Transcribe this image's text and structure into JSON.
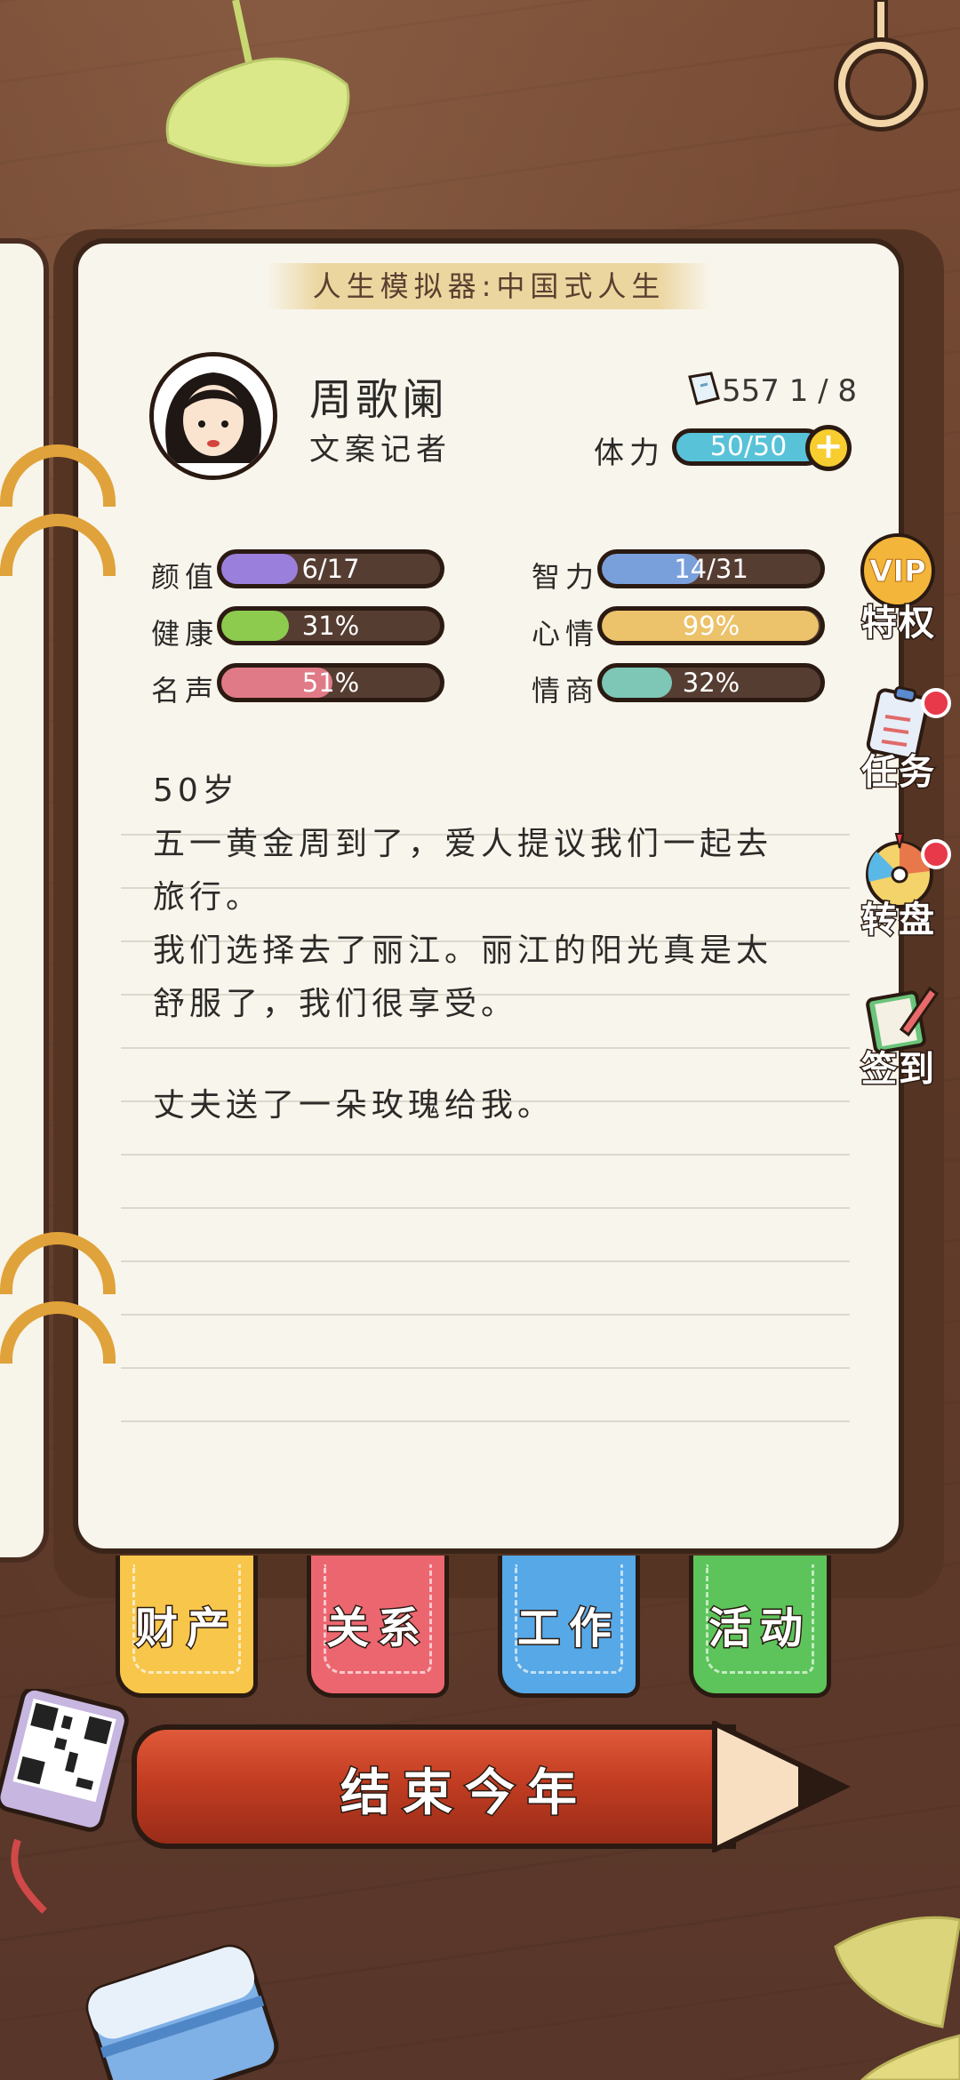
{
  "header": {
    "title": "人生模拟器:中国式人生"
  },
  "profile": {
    "name": "周歌阑",
    "job": "文案记者",
    "coins": "557 1 / 8",
    "stamina_label": "体力",
    "stamina_value": "50/50"
  },
  "stats": [
    {
      "label": "颜值",
      "value": "6/17",
      "fill": 0.35,
      "color": "#9b7fdc"
    },
    {
      "label": "健康",
      "value": "31%",
      "fill": 0.31,
      "color": "#8ccb4e"
    },
    {
      "label": "名声",
      "value": "51%",
      "fill": 0.51,
      "color": "#e07a86"
    },
    {
      "label": "智力",
      "value": "14/31",
      "fill": 0.45,
      "color": "#7aa0dc"
    },
    {
      "label": "心情",
      "value": "99%",
      "fill": 0.99,
      "color": "#ecc26a"
    },
    {
      "label": "情商",
      "value": "32%",
      "fill": 0.32,
      "color": "#7ec6b6"
    }
  ],
  "story": {
    "age": "50岁",
    "line1": "五一黄金周到了，爱人提议我们一起去",
    "line2": "旅行。",
    "line3": "我们选择去了丽江。丽江的阳光真是太",
    "line4": "舒服了，我们很享受。",
    "line5": "丈夫送了一朵玫瑰给我。"
  },
  "side": {
    "vip_badge": "VIP",
    "vip": "特权",
    "task": "任务",
    "wheel": "转盘",
    "checkin": "签到"
  },
  "tabs": [
    {
      "label": "财产",
      "color": "#f7c64a"
    },
    {
      "label": "关系",
      "color": "#ec6670"
    },
    {
      "label": "工作",
      "color": "#56a8e6"
    },
    {
      "label": "活动",
      "color": "#5cc45a"
    }
  ],
  "footer": {
    "end_year": "结束今年"
  }
}
